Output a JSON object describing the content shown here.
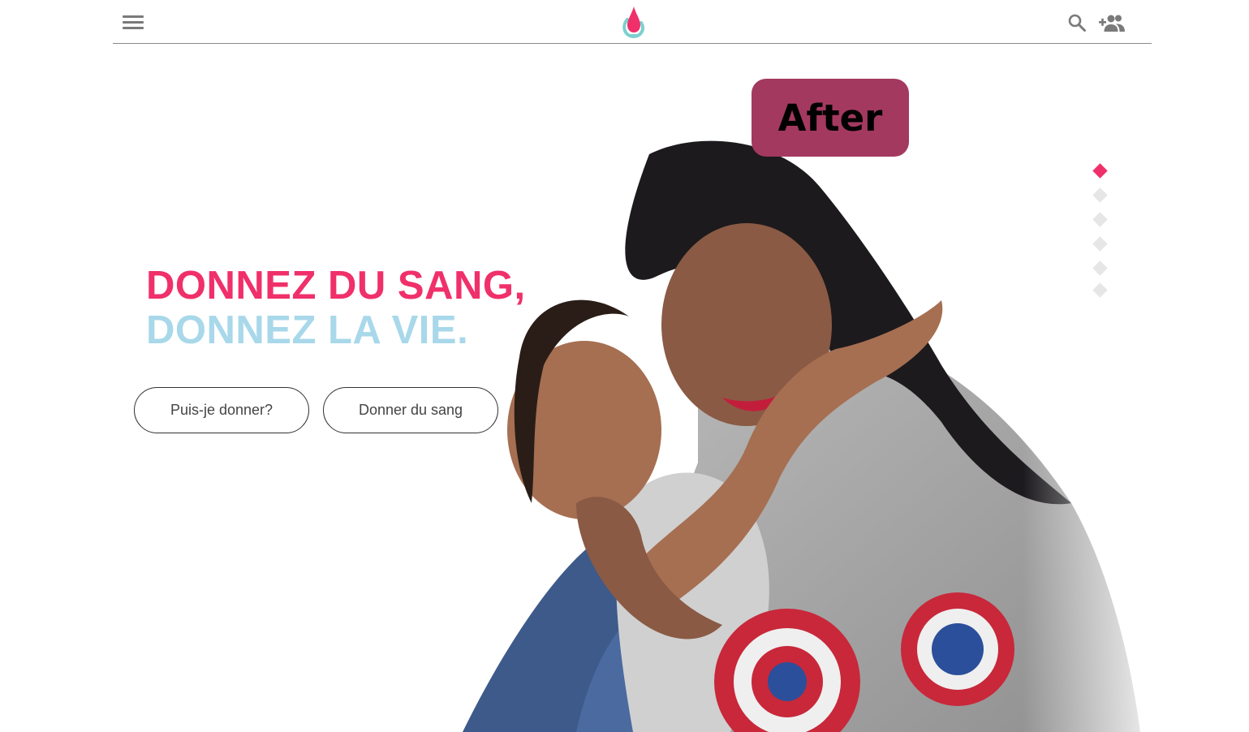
{
  "header": {
    "menu_icon": "hamburger-menu-icon",
    "logo_icon": "blood-drop-logo-icon",
    "search_icon": "search-icon",
    "add_user_icon": "add-group-user-icon"
  },
  "badge": {
    "label": "After"
  },
  "hero": {
    "headline_line1": "DONNEZ DU SANG,",
    "headline_line2": "DONNEZ LA VIE.",
    "buttons": [
      {
        "label": "Puis-je donner?"
      },
      {
        "label": "Donner du sang"
      }
    ],
    "image": "photo-mother-hugging-child"
  },
  "slider": {
    "count": 6,
    "active_index": 0
  },
  "colors": {
    "brand_pink": "#f0306a",
    "brand_light_blue": "#a8d8ea",
    "badge_bg": "#a3395f",
    "icon_gray": "#7a7a7a"
  }
}
